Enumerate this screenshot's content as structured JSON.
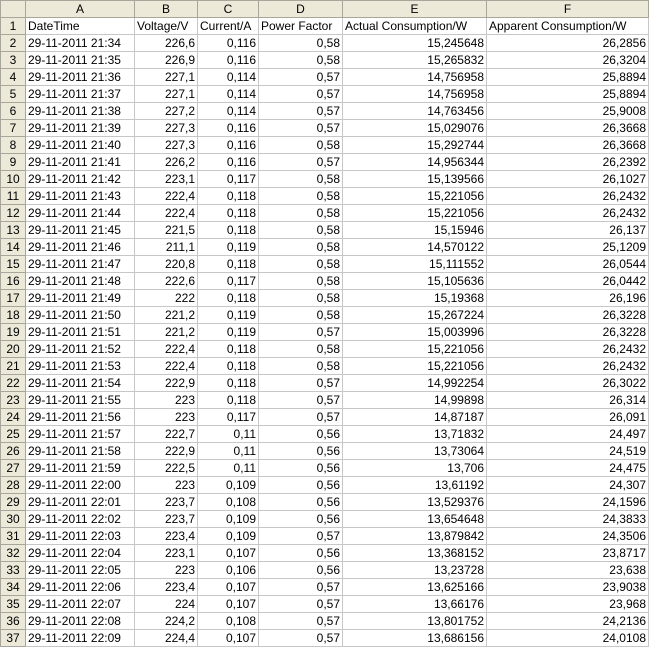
{
  "columns": [
    "A",
    "B",
    "C",
    "D",
    "E",
    "F"
  ],
  "header_row": {
    "row_number": "1",
    "cells": [
      "DateTime",
      "Voltage/V",
      "Current/A",
      "Power Factor",
      "Actual Consumption/W",
      "Apparent Consumption/W"
    ]
  },
  "rows": [
    {
      "n": "2",
      "cells": [
        "29-11-2011 21:34",
        "226,6",
        "0,116",
        "0,58",
        "15,245648",
        "26,2856"
      ]
    },
    {
      "n": "3",
      "cells": [
        "29-11-2011 21:35",
        "226,9",
        "0,116",
        "0,58",
        "15,265832",
        "26,3204"
      ]
    },
    {
      "n": "4",
      "cells": [
        "29-11-2011 21:36",
        "227,1",
        "0,114",
        "0,57",
        "14,756958",
        "25,8894"
      ]
    },
    {
      "n": "5",
      "cells": [
        "29-11-2011 21:37",
        "227,1",
        "0,114",
        "0,57",
        "14,756958",
        "25,8894"
      ]
    },
    {
      "n": "6",
      "cells": [
        "29-11-2011 21:38",
        "227,2",
        "0,114",
        "0,57",
        "14,763456",
        "25,9008"
      ]
    },
    {
      "n": "7",
      "cells": [
        "29-11-2011 21:39",
        "227,3",
        "0,116",
        "0,57",
        "15,029076",
        "26,3668"
      ]
    },
    {
      "n": "8",
      "cells": [
        "29-11-2011 21:40",
        "227,3",
        "0,116",
        "0,58",
        "15,292744",
        "26,3668"
      ]
    },
    {
      "n": "9",
      "cells": [
        "29-11-2011 21:41",
        "226,2",
        "0,116",
        "0,57",
        "14,956344",
        "26,2392"
      ]
    },
    {
      "n": "10",
      "cells": [
        "29-11-2011 21:42",
        "223,1",
        "0,117",
        "0,58",
        "15,139566",
        "26,1027"
      ]
    },
    {
      "n": "11",
      "cells": [
        "29-11-2011 21:43",
        "222,4",
        "0,118",
        "0,58",
        "15,221056",
        "26,2432"
      ]
    },
    {
      "n": "12",
      "cells": [
        "29-11-2011 21:44",
        "222,4",
        "0,118",
        "0,58",
        "15,221056",
        "26,2432"
      ]
    },
    {
      "n": "13",
      "cells": [
        "29-11-2011 21:45",
        "221,5",
        "0,118",
        "0,58",
        "15,15946",
        "26,137"
      ]
    },
    {
      "n": "14",
      "cells": [
        "29-11-2011 21:46",
        "211,1",
        "0,119",
        "0,58",
        "14,570122",
        "25,1209"
      ]
    },
    {
      "n": "15",
      "cells": [
        "29-11-2011 21:47",
        "220,8",
        "0,118",
        "0,58",
        "15,111552",
        "26,0544"
      ]
    },
    {
      "n": "16",
      "cells": [
        "29-11-2011 21:48",
        "222,6",
        "0,117",
        "0,58",
        "15,105636",
        "26,0442"
      ]
    },
    {
      "n": "17",
      "cells": [
        "29-11-2011 21:49",
        "222",
        "0,118",
        "0,58",
        "15,19368",
        "26,196"
      ]
    },
    {
      "n": "18",
      "cells": [
        "29-11-2011 21:50",
        "221,2",
        "0,119",
        "0,58",
        "15,267224",
        "26,3228"
      ]
    },
    {
      "n": "19",
      "cells": [
        "29-11-2011 21:51",
        "221,2",
        "0,119",
        "0,57",
        "15,003996",
        "26,3228"
      ]
    },
    {
      "n": "20",
      "cells": [
        "29-11-2011 21:52",
        "222,4",
        "0,118",
        "0,58",
        "15,221056",
        "26,2432"
      ]
    },
    {
      "n": "21",
      "cells": [
        "29-11-2011 21:53",
        "222,4",
        "0,118",
        "0,58",
        "15,221056",
        "26,2432"
      ]
    },
    {
      "n": "22",
      "cells": [
        "29-11-2011 21:54",
        "222,9",
        "0,118",
        "0,57",
        "14,992254",
        "26,3022"
      ]
    },
    {
      "n": "23",
      "cells": [
        "29-11-2011 21:55",
        "223",
        "0,118",
        "0,57",
        "14,99898",
        "26,314"
      ]
    },
    {
      "n": "24",
      "cells": [
        "29-11-2011 21:56",
        "223",
        "0,117",
        "0,57",
        "14,87187",
        "26,091"
      ]
    },
    {
      "n": "25",
      "cells": [
        "29-11-2011 21:57",
        "222,7",
        "0,11",
        "0,56",
        "13,71832",
        "24,497"
      ]
    },
    {
      "n": "26",
      "cells": [
        "29-11-2011 21:58",
        "222,9",
        "0,11",
        "0,56",
        "13,73064",
        "24,519"
      ]
    },
    {
      "n": "27",
      "cells": [
        "29-11-2011 21:59",
        "222,5",
        "0,11",
        "0,56",
        "13,706",
        "24,475"
      ]
    },
    {
      "n": "28",
      "cells": [
        "29-11-2011 22:00",
        "223",
        "0,109",
        "0,56",
        "13,61192",
        "24,307"
      ]
    },
    {
      "n": "29",
      "cells": [
        "29-11-2011 22:01",
        "223,7",
        "0,108",
        "0,56",
        "13,529376",
        "24,1596"
      ]
    },
    {
      "n": "30",
      "cells": [
        "29-11-2011 22:02",
        "223,7",
        "0,109",
        "0,56",
        "13,654648",
        "24,3833"
      ]
    },
    {
      "n": "31",
      "cells": [
        "29-11-2011 22:03",
        "223,4",
        "0,109",
        "0,57",
        "13,879842",
        "24,3506"
      ]
    },
    {
      "n": "32",
      "cells": [
        "29-11-2011 22:04",
        "223,1",
        "0,107",
        "0,56",
        "13,368152",
        "23,8717"
      ]
    },
    {
      "n": "33",
      "cells": [
        "29-11-2011 22:05",
        "223",
        "0,106",
        "0,56",
        "13,23728",
        "23,638"
      ]
    },
    {
      "n": "34",
      "cells": [
        "29-11-2011 22:06",
        "223,4",
        "0,107",
        "0,57",
        "13,625166",
        "23,9038"
      ]
    },
    {
      "n": "35",
      "cells": [
        "29-11-2011 22:07",
        "224",
        "0,107",
        "0,57",
        "13,66176",
        "23,968"
      ]
    },
    {
      "n": "36",
      "cells": [
        "29-11-2011 22:08",
        "224,2",
        "0,108",
        "0,57",
        "13,801752",
        "24,2136"
      ]
    },
    {
      "n": "37",
      "cells": [
        "29-11-2011 22:09",
        "224,4",
        "0,107",
        "0,57",
        "13,686156",
        "24,0108"
      ]
    }
  ]
}
